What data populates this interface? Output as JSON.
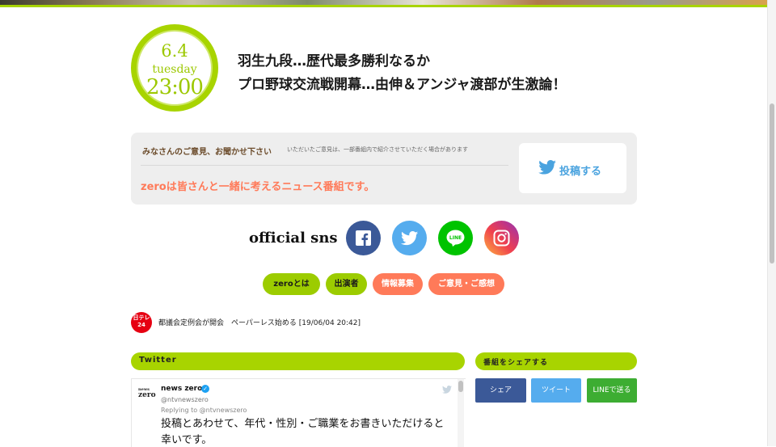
{
  "badge": {
    "date": "6.4",
    "day": "tuesday",
    "time": "23:00"
  },
  "headline": {
    "line1": "羽生九段…歴代最多勝利なるか",
    "line2": "プロ野球交流戦開幕…由伸＆アンジャ渡部が生激論！"
  },
  "feedback": {
    "title": "みなさんのご意見、お聞かせ下さい",
    "note": "いただいたご意見は、一部番組内で紹介させていただく場合があります",
    "catch": "zeroは皆さんと一緒に考えるニュース番組です。",
    "post_label": "投稿する"
  },
  "sns": {
    "label": "official sns",
    "icons": [
      "facebook-icon",
      "twitter-icon",
      "line-icon",
      "instagram-icon"
    ]
  },
  "nav": {
    "about": "zeroとは",
    "cast": "出演者",
    "info": "情報募集",
    "opinion": "ご意見・ご感想"
  },
  "news": {
    "logo": "日テレNEWS24",
    "text": "都議会定例会が開会　ペーパーレス始める [19/06/04 20:42]"
  },
  "sections": {
    "twitter": "Twitter",
    "share": "番組をシェアする"
  },
  "tweet": {
    "avatar": "news zero",
    "name": "news zero",
    "handle": "@ntvnewszero",
    "reply": "Replying to @ntvnewszero",
    "body": "投稿とあわせて、年代・性別・ご職業をお書きいただけると幸いです。"
  },
  "share": {
    "facebook": "シェア",
    "twitter": "ツイート",
    "line": "LINEで送る"
  },
  "colors": {
    "accent_green": "#a8d400",
    "accent_orange": "#ff7a59",
    "facebook": "#3b5998",
    "twitter": "#55acee",
    "line": "#00c300"
  }
}
